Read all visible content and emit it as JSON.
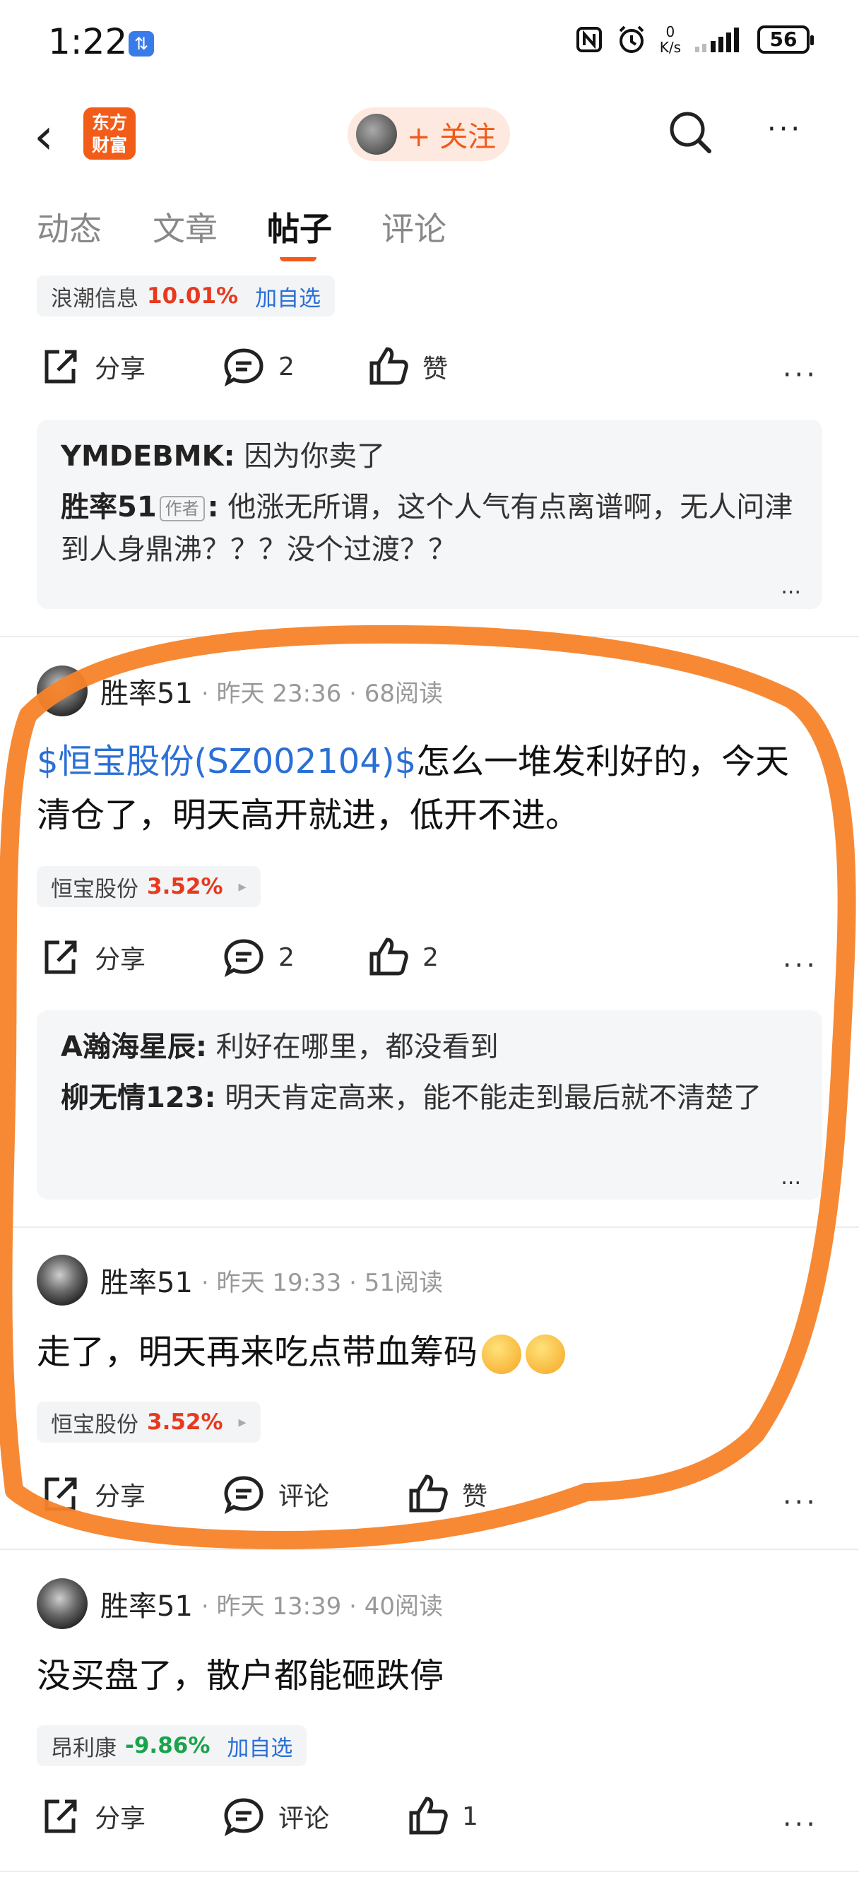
{
  "status": {
    "time": "1:22",
    "sim_badge": "⇅",
    "net_speed_top": "0",
    "net_speed_unit": "K/s",
    "battery": "56"
  },
  "nav": {
    "back_glyph": "‹",
    "logo_line1": "东方",
    "logo_line2": "财富",
    "follow_label": "+ 关注",
    "more_glyph": "···"
  },
  "tabs": [
    "动态",
    "文章",
    "帖子",
    "评论"
  ],
  "post0": {
    "chip": {
      "name": "浪潮信息",
      "pct": "10.01%",
      "add": "加自选"
    },
    "actions": {
      "share": "分享",
      "comment": "2",
      "like": "赞"
    },
    "comments": [
      {
        "user": "YMDEBMK",
        "sep": ":",
        "text": "因为你卖了"
      },
      {
        "user": "胜率51",
        "author_tag": "作者",
        "sep": ":",
        "text": "他涨无所谓，这个人气有点离谱啊，无人问津到人身鼎沸？？？没个过渡？？"
      }
    ],
    "more": "..."
  },
  "post1": {
    "name": "胜率51",
    "meta": "· 昨天 23:36 · 68阅读",
    "tag": "$恒宝股份(SZ002104)$",
    "text": "怎么一堆发利好的，今天清仓了，明天高开就进，低开不进。",
    "chip": {
      "name": "恒宝股份",
      "pct": "3.52%",
      "arrow": "▸"
    },
    "actions": {
      "share": "分享",
      "comment": "2",
      "like": "2"
    },
    "comments": [
      {
        "user": "A瀚海星辰",
        "sep": ":",
        "text": "利好在哪里，都没看到"
      },
      {
        "user": "柳无情123",
        "sep": ":",
        "text": "明天肯定高来，能不能走到最后就不清楚了"
      }
    ],
    "more": "..."
  },
  "post2": {
    "name": "胜率51",
    "meta": "· 昨天 19:33 · 51阅读",
    "text": "走了，明天再来吃点带血筹码",
    "chip": {
      "name": "恒宝股份",
      "pct": "3.52%",
      "arrow": "▸"
    },
    "actions": {
      "share": "分享",
      "comment": "评论",
      "like": "赞"
    }
  },
  "post3": {
    "name": "胜率51",
    "meta": "· 昨天 13:39 · 40阅读",
    "text": "没买盘了，散户都能砸跌停",
    "chip": {
      "name": "昂利康",
      "pct": "-9.86%",
      "add": "加自选"
    },
    "actions": {
      "share": "分享",
      "comment": "评论",
      "like": "1"
    }
  },
  "colors": {
    "accent": "#f05a1a",
    "link": "#2a6fd6",
    "up": "#e8391e",
    "down": "#1aa34a",
    "annotation": "#f7832a"
  }
}
